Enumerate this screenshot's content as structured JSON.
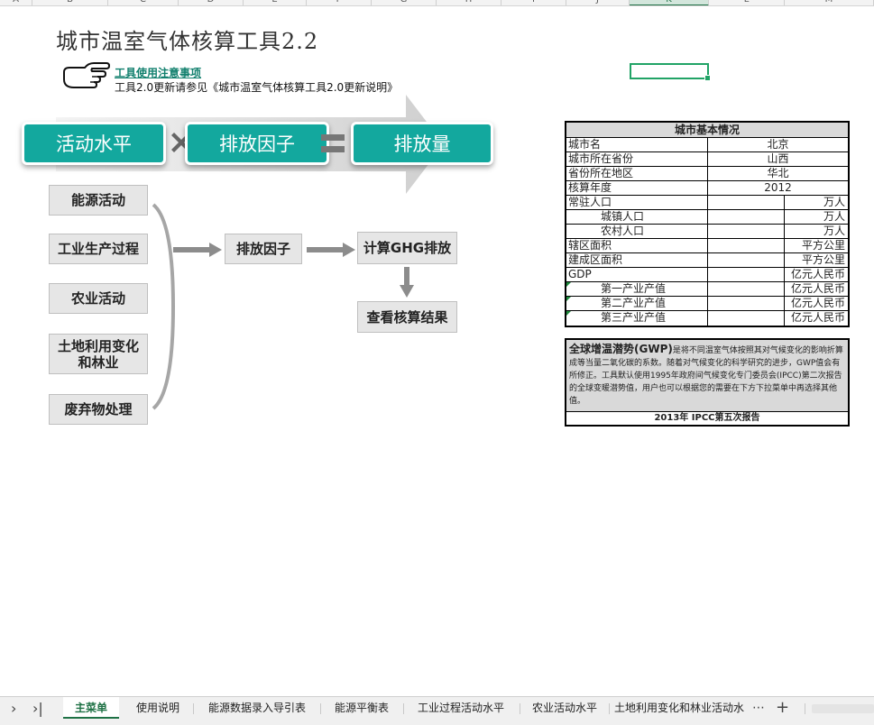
{
  "columns": [
    "A",
    "B",
    "C",
    "D",
    "E",
    "F",
    "G",
    "H",
    "I",
    "J",
    "K",
    "L",
    "M"
  ],
  "selected_column": "K",
  "title": "城市温室气体核算工具2.2",
  "notice": {
    "link": "工具使用注意事项",
    "text": "工具2.0更新请参见《城市温室气体核算工具2.0更新说明》"
  },
  "banner": {
    "activity": "活动水平",
    "factor": "排放因子",
    "emission": "排放量"
  },
  "flow": {
    "sources": [
      "能源活动",
      "工业生产过程",
      "农业活动",
      "土地利用变化\n和林业",
      "废弃物处理"
    ],
    "factor": "排放因子",
    "calc": "计算GHG排放",
    "result": "查看核算结果"
  },
  "city_info": {
    "header": "城市基本情况",
    "rows": [
      {
        "label": "城市名",
        "value": "北京"
      },
      {
        "label": "城市所在省份",
        "value": "山西"
      },
      {
        "label": "省份所在地区",
        "value": "华北"
      },
      {
        "label": "核算年度",
        "value": "2012"
      },
      {
        "label": "常驻人口",
        "unit": "万人"
      },
      {
        "label": "城镇人口",
        "unit": "万人"
      },
      {
        "label": "农村人口",
        "unit": "万人"
      },
      {
        "label": "辖区面积",
        "unit": "平方公里"
      },
      {
        "label": "建成区面积",
        "unit": "平方公里"
      },
      {
        "label": "GDP",
        "unit": "亿元人民币"
      },
      {
        "label": "第一产业产值",
        "unit": "亿元人民币"
      },
      {
        "label": "第二产业产值",
        "unit": "亿元人民币"
      },
      {
        "label": "第三产业产值",
        "unit": "亿元人民币"
      }
    ]
  },
  "gwp": {
    "heading": "全球增温潜势(GWP)",
    "text": "是将不同温室气体按照其对气候变化的影响折算成等当量二氧化碳的系数。随着对气候变化的科学研究的进步，GWP值会有所修正。工具默认使用1995年政府间气候变化专门委员会(IPCC)第二次报告的全球变暖潜势值，用户也可以根据您的需要在下方下拉菜单中再选择其他值。",
    "selected": "2013年 IPCC第五次报告"
  },
  "sheet_tabs": [
    "主菜单",
    "使用说明",
    "能源数据录入导引表",
    "能源平衡表",
    "工业过程活动水平",
    "农业活动水平",
    "土地利用变化和林业活动水"
  ],
  "tabs_more": "⋯",
  "tabs_add": "+",
  "colors": {
    "accent": "#13a89e",
    "excel_green": "#1e7145"
  }
}
